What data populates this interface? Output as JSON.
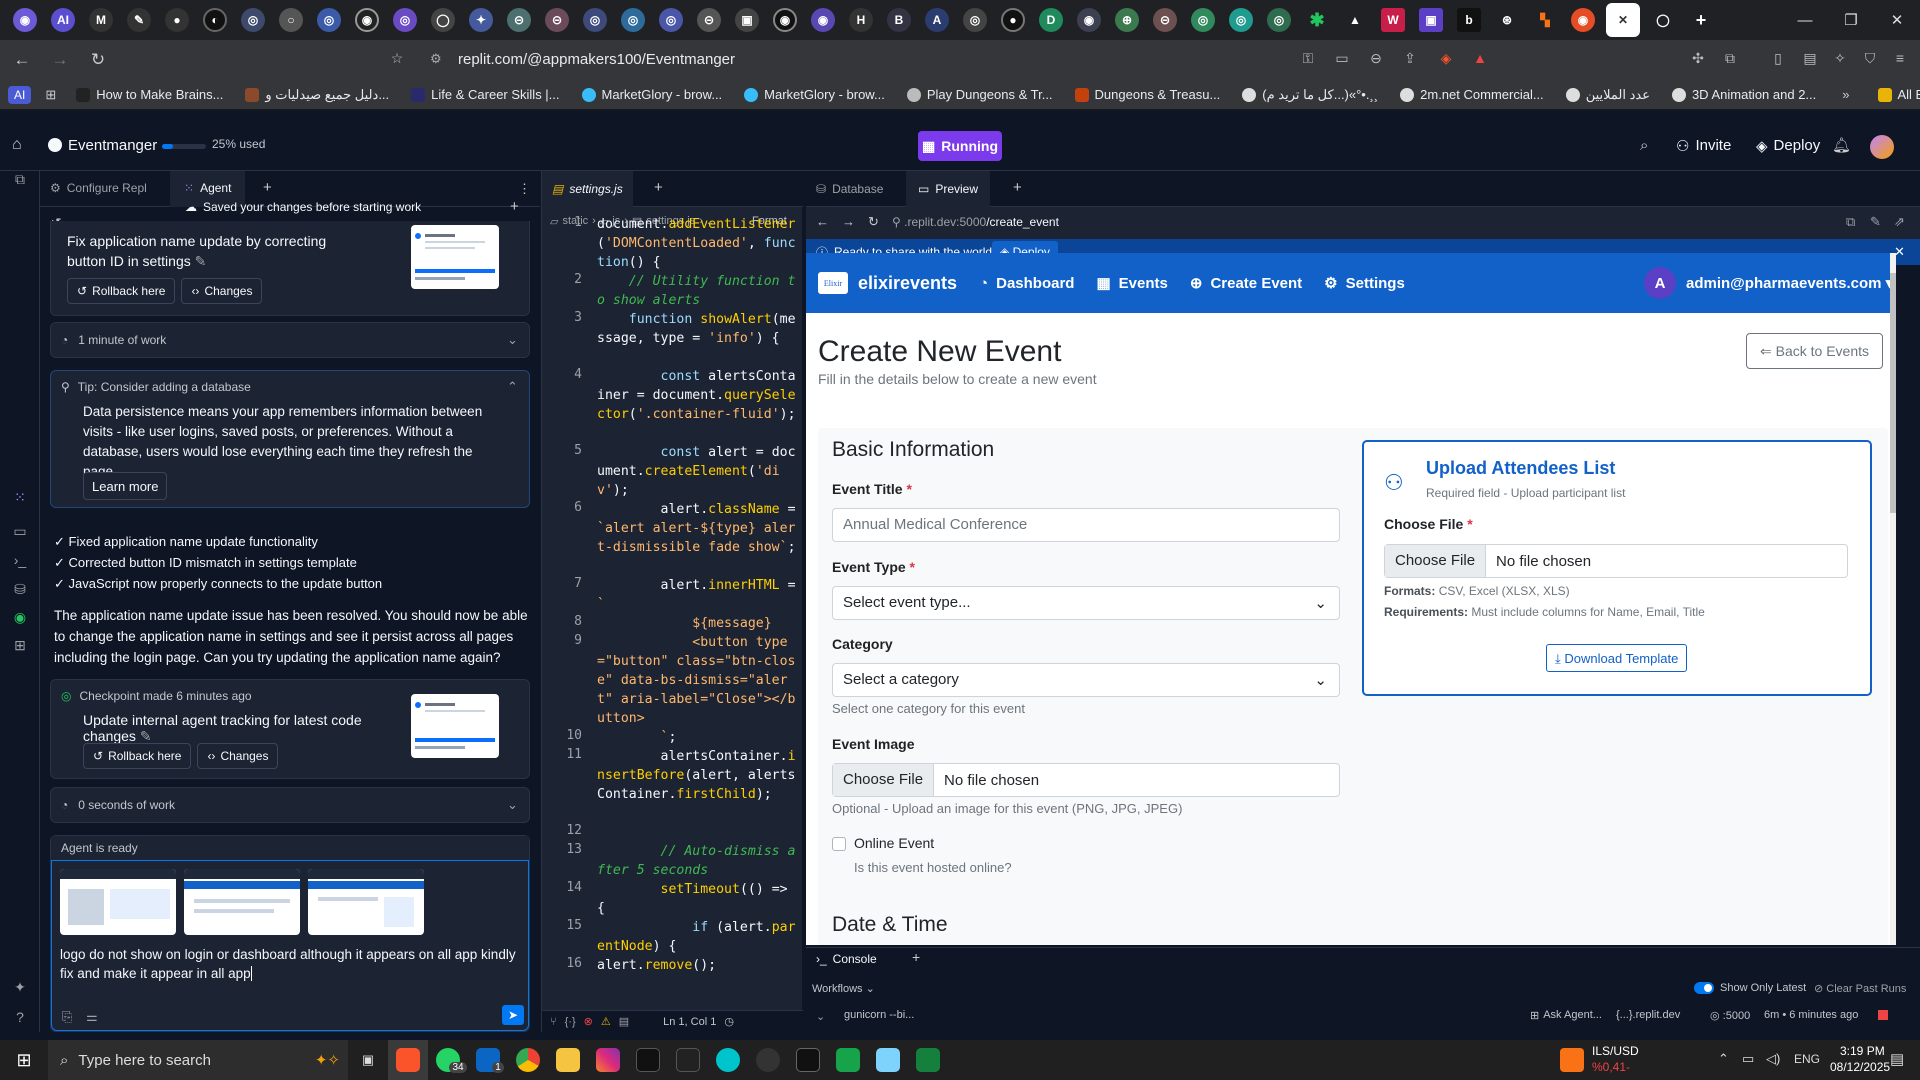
{
  "browser": {
    "url": "replit.com/@appmakers100/Eventmanger",
    "bookmarks": [
      "How to Make Brains...",
      "دليل جميع صيدليات و...",
      "Life & Career Skills |...",
      "MarketGlory - brow...",
      "MarketGlory - brow...",
      "Play Dungeons & Tr...",
      "Dungeons & Treasu...",
      "(كل ما تريد م...)«°•.¸¸",
      "2m.net Commercial...",
      "عدد الملايين",
      "3D Animation and 2..."
    ],
    "all_bookmarks": "All Bookmarks",
    "bm_ai": "AI"
  },
  "replit": {
    "project_name": "Eventmanger",
    "usage": "25% used",
    "usage_fraction": 0.25,
    "run_label": "Running",
    "invite": "Invite",
    "deploy": "Deploy"
  },
  "agent": {
    "tab_configure": "Configure Repl",
    "tab_agent": "Agent",
    "saved_msg": "Saved your changes before starting work",
    "checkpoint1_title": "Fix application name update by correcting button ID in settings",
    "rollback": "Rollback here",
    "changes": "Changes",
    "work1": "1 minute of work",
    "tip_title": "Tip: Consider adding a database",
    "tip_body": "Data persistence means your app remembers information between visits - like user logins, saved posts, or preferences. Without a database, users would lose everything each time they refresh the page.",
    "learn_more": "Learn more",
    "checks": [
      "✓ Fixed application name update functionality",
      "✓ Corrected button ID mismatch in settings template",
      "✓ JavaScript now properly connects to the update button"
    ],
    "summary": "The application name update issue has been resolved. You should now be able to change the application name in settings and see it persist across all pages including the login page. Can you try updating the application name again?",
    "checkpoint2_meta": "Checkpoint made 6 minutes ago",
    "checkpoint2_title": "Update internal agent tracking for latest code changes",
    "work2": "0 seconds of work",
    "ready": "Agent is ready",
    "input_text": "logo do not show on login or dashboard although it appears on all app kindly fix and make it appear in all app"
  },
  "editor": {
    "tab": "settings.js",
    "breadcrumb": [
      "static",
      "js",
      "settings.js",
      "..."
    ],
    "format": "Format",
    "line_numbers": [
      "1",
      "2",
      "3",
      "4",
      "5",
      "6",
      "7",
      "8",
      "9",
      "10",
      "11",
      "12",
      "13",
      "14",
      "15",
      "16"
    ],
    "status": "Ln 1, Col 1"
  },
  "preview": {
    "tab_database": "Database",
    "tab_preview": "Preview",
    "url_prefix": ".replit.dev:5000",
    "url_path": "/create_event",
    "share_msg": "Ready to share with the world?",
    "share_deploy": "Deploy"
  },
  "app": {
    "brand": "elixirevents",
    "brand_logo": "Elixir",
    "nav": [
      "Dashboard",
      "Events",
      "Create Event",
      "Settings"
    ],
    "avatar": "A",
    "user": "admin@pharmaevents.com",
    "page_title": "Create New Event",
    "page_subtitle": "Fill in the details below to create a new event",
    "back": "Back to Events",
    "section_basic": "Basic Information",
    "event_title_label": "Event Title",
    "event_title_placeholder": "Annual Medical Conference",
    "event_type_label": "Event Type",
    "event_type_value": "Select event type...",
    "category_label": "Category",
    "category_value": "Select a category",
    "category_hint": "Select one category for this event",
    "image_label": "Event Image",
    "choose_file": "Choose File",
    "no_file": "No file chosen",
    "image_hint": "Optional - Upload an image for this event (PNG, JPG, JPEG)",
    "online_label": "Online Event",
    "online_hint": "Is this event hosted online?",
    "section_date": "Date & Time",
    "upload_title": "Upload Attendees List",
    "upload_sub": "Required field - Upload participant list",
    "upload_choose_label": "Choose File",
    "formats_label": "Formats:",
    "formats_value": "CSV, Excel (XLSX, XLS)",
    "req_label": "Requirements:",
    "req_value": "Must include columns for Name, Email, Title",
    "download": "Download Template",
    "required_mark": "*"
  },
  "console": {
    "tab": "Console",
    "workflows": "Workflows",
    "show_latest": "Show Only Latest",
    "clear": "Clear Past Runs",
    "process": "gunicorn --bi...",
    "ask_agent": "Ask Agent...",
    "domain": "{...}.replit.dev",
    "port": ":5000",
    "elapsed": "6m • 6 minutes ago"
  },
  "taskbar": {
    "search": "Type here to search",
    "currency": "ILS/USD",
    "change": "%0,41-",
    "lang": "ENG",
    "time": "3:19 PM",
    "date": "08/12/2025",
    "badge_whatsapp": "34",
    "badge_linkedin": "1"
  },
  "colors": {
    "replit_bg": "#0e1525",
    "panel": "#1c2333",
    "accent_purple": "#7c3aed",
    "app_blue": "#1161c8"
  }
}
